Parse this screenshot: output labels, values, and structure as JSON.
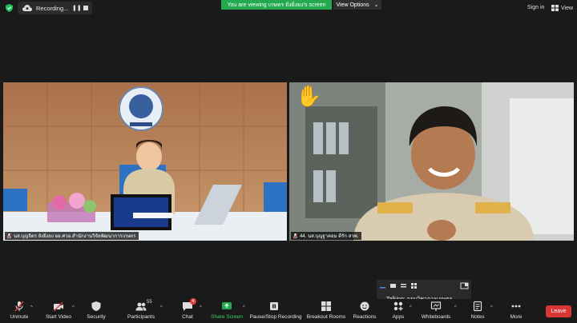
{
  "topbar": {
    "recording_label": "Recording...",
    "pause_glyph": "❚❚",
    "viewing_banner": "You are viewing เกษตร ยังยิ่งยง's screen",
    "view_options_label": "View Options",
    "view_options_caret": "⌄",
    "sign_in": "Sign in",
    "view_label": "View"
  },
  "tiles": [
    {
      "name": "นส.บุญจิตร ยังยิ่งยง ผอ.ศวอ.สำนักงานวิจัยพัฒนาการเกษตร",
      "muted": true
    },
    {
      "name": "44. นส.บุญฐาคอม ดีรัก สวพ.",
      "muted": true,
      "hand_raised": "✋"
    }
  ],
  "talking": {
    "label": "Talking: กรมวิชาการเกษตร"
  },
  "toolbar": {
    "items": [
      {
        "label": "Unmute",
        "icon": "mic-muted-icon"
      },
      {
        "label": "Start Video",
        "icon": "video-off-icon"
      },
      {
        "label": "Security",
        "icon": "shield-icon"
      },
      {
        "label": "Participants",
        "icon": "participants-icon",
        "count": "55"
      },
      {
        "label": "Chat",
        "icon": "chat-icon",
        "badge": "4"
      },
      {
        "label": "Share Screen",
        "icon": "share-screen-icon"
      },
      {
        "label": "Pause/Stop Recording",
        "icon": "pause-stop-icon"
      },
      {
        "label": "Breakout Rooms",
        "icon": "breakout-rooms-icon"
      },
      {
        "label": "Reactions",
        "icon": "reactions-icon"
      },
      {
        "label": "Apps",
        "icon": "apps-icon"
      },
      {
        "label": "Whiteboards",
        "icon": "whiteboards-icon"
      },
      {
        "label": "Notes",
        "icon": "notes-icon"
      },
      {
        "label": "More",
        "icon": "more-icon"
      }
    ],
    "caret": "^",
    "leave_label": "Leave"
  },
  "colors": {
    "background": "#1a1a1a",
    "banner_green": "#23a94e",
    "leave_red": "#d93636",
    "share_green": "#3fd16a"
  }
}
